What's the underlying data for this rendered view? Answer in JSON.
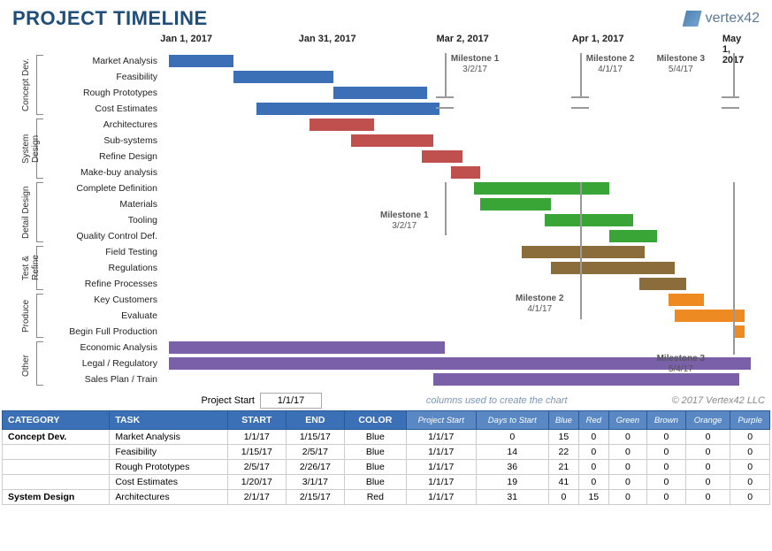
{
  "header": {
    "title": "PROJECT TIMELINE",
    "brand": "vertex42"
  },
  "axis": {
    "dates": [
      "Jan 1, 2017",
      "Jan 31, 2017",
      "Mar 2, 2017",
      "Apr 1, 2017",
      "May 1, 2017"
    ]
  },
  "milestones": [
    {
      "name": "Milestone 1",
      "date": "3/2/17"
    },
    {
      "name": "Milestone 2",
      "date": "4/1/17"
    },
    {
      "name": "Milestone 3",
      "date": "5/4/17"
    }
  ],
  "groups": [
    {
      "name": "Concept Dev.",
      "tasks": [
        "Market Analysis",
        "Feasibility",
        "Rough Prototypes",
        "Cost Estimates"
      ]
    },
    {
      "name": "System Design",
      "tasks": [
        "Architectures",
        "Sub-systems",
        "Refine Design",
        "Make-buy analysis"
      ]
    },
    {
      "name": "Detail Design",
      "tasks": [
        "Complete Definition",
        "Materials",
        "Tooling",
        "Quality Control Def."
      ]
    },
    {
      "name": "Test & Refine",
      "tasks": [
        "Field Testing",
        "Regulations",
        "Refine Processes"
      ]
    },
    {
      "name": "Produce",
      "tasks": [
        "Key Customers",
        "Evaluate",
        "Begin Full Production"
      ]
    },
    {
      "name": "Other",
      "tasks": [
        "Economic Analysis",
        "Legal / Regulatory",
        "Sales Plan / Train"
      ]
    }
  ],
  "milestone_repeat": [
    {
      "name": "Milestone 1",
      "date": "3/2/17"
    },
    {
      "name": "Milestone 2",
      "date": "4/1/17"
    },
    {
      "name": "Milestone 3",
      "date": "5/4/17"
    }
  ],
  "project_start_label": "Project Start",
  "project_start_value": "1/1/17",
  "columns_note": "columns used to create the chart",
  "copyright": "© 2017 Vertex42 LLC",
  "col_headers": [
    "CATEGORY",
    "TASK",
    "START",
    "END",
    "COLOR",
    "Project Start",
    "Days to Start",
    "Blue",
    "Red",
    "Green",
    "Brown",
    "Orange",
    "Purple"
  ],
  "rows": [
    {
      "cat": "Concept Dev.",
      "task": "Market Analysis",
      "start": "1/1/17",
      "end": "1/15/17",
      "color": "Blue",
      "ps": "1/1/17",
      "dts": "0",
      "b": "15",
      "r": "0",
      "g": "0",
      "br": "0",
      "o": "0",
      "p": "0"
    },
    {
      "cat": "",
      "task": "Feasibility",
      "start": "1/15/17",
      "end": "2/5/17",
      "color": "Blue",
      "ps": "1/1/17",
      "dts": "14",
      "b": "22",
      "r": "0",
      "g": "0",
      "br": "0",
      "o": "0",
      "p": "0"
    },
    {
      "cat": "",
      "task": "Rough Prototypes",
      "start": "2/5/17",
      "end": "2/26/17",
      "color": "Blue",
      "ps": "1/1/17",
      "dts": "36",
      "b": "21",
      "r": "0",
      "g": "0",
      "br": "0",
      "o": "0",
      "p": "0"
    },
    {
      "cat": "",
      "task": "Cost Estimates",
      "start": "1/20/17",
      "end": "3/1/17",
      "color": "Blue",
      "ps": "1/1/17",
      "dts": "19",
      "b": "41",
      "r": "0",
      "g": "0",
      "br": "0",
      "o": "0",
      "p": "0"
    },
    {
      "cat": "System Design",
      "task": "Architectures",
      "start": "2/1/17",
      "end": "2/15/17",
      "color": "Red",
      "ps": "1/1/17",
      "dts": "31",
      "b": "0",
      "r": "15",
      "g": "0",
      "br": "0",
      "o": "0",
      "p": "0"
    }
  ],
  "chart_data": {
    "type": "gantt",
    "title": "PROJECT TIMELINE",
    "x_axis": {
      "start": "2017-01-01",
      "end": "2017-05-07",
      "ticks": [
        "2017-01-01",
        "2017-01-31",
        "2017-03-02",
        "2017-04-01",
        "2017-05-01"
      ]
    },
    "milestones": [
      {
        "name": "Milestone 1",
        "date": "2017-03-02"
      },
      {
        "name": "Milestone 2",
        "date": "2017-04-01"
      },
      {
        "name": "Milestone 3",
        "date": "2017-05-04"
      }
    ],
    "groups": [
      {
        "name": "Concept Dev.",
        "color": "Blue",
        "tasks": [
          {
            "name": "Market Analysis",
            "start": "2017-01-01",
            "end": "2017-01-15"
          },
          {
            "name": "Feasibility",
            "start": "2017-01-15",
            "end": "2017-02-05"
          },
          {
            "name": "Rough Prototypes",
            "start": "2017-02-05",
            "end": "2017-02-26"
          },
          {
            "name": "Cost Estimates",
            "start": "2017-01-20",
            "end": "2017-03-01"
          }
        ]
      },
      {
        "name": "System Design",
        "color": "Red",
        "tasks": [
          {
            "name": "Architectures",
            "start": "2017-02-01",
            "end": "2017-02-15"
          },
          {
            "name": "Sub-systems",
            "start": "2017-02-10",
            "end": "2017-02-28"
          },
          {
            "name": "Refine Design",
            "start": "2017-02-25",
            "end": "2017-03-05"
          },
          {
            "name": "Make-buy analysis",
            "start": "2017-03-03",
            "end": "2017-03-09"
          }
        ]
      },
      {
        "name": "Detail Design",
        "color": "Green",
        "tasks": [
          {
            "name": "Complete Definition",
            "start": "2017-03-09",
            "end": "2017-04-08"
          },
          {
            "name": "Materials",
            "start": "2017-03-10",
            "end": "2017-03-25"
          },
          {
            "name": "Tooling",
            "start": "2017-03-24",
            "end": "2017-04-12"
          },
          {
            "name": "Quality Control Def.",
            "start": "2017-04-08",
            "end": "2017-04-18"
          }
        ]
      },
      {
        "name": "Test & Refine",
        "color": "Brown",
        "tasks": [
          {
            "name": "Field Testing",
            "start": "2017-03-20",
            "end": "2017-04-16"
          },
          {
            "name": "Regulations",
            "start": "2017-03-26",
            "end": "2017-04-22"
          },
          {
            "name": "Refine Processes",
            "start": "2017-04-14",
            "end": "2017-04-24"
          }
        ]
      },
      {
        "name": "Produce",
        "color": "Orange",
        "tasks": [
          {
            "name": "Key Customers",
            "start": "2017-04-20",
            "end": "2017-04-28"
          },
          {
            "name": "Evaluate",
            "start": "2017-04-22",
            "end": "2017-05-07"
          },
          {
            "name": "Begin Full Production",
            "start": "2017-05-04",
            "end": "2017-05-07"
          }
        ]
      },
      {
        "name": "Other",
        "color": "Purple",
        "tasks": [
          {
            "name": "Economic Analysis",
            "start": "2017-01-01",
            "end": "2017-03-02"
          },
          {
            "name": "Legal / Regulatory",
            "start": "2017-01-01",
            "end": "2017-05-07"
          },
          {
            "name": "Sales Plan / Train",
            "start": "2017-02-28",
            "end": "2017-05-02"
          }
        ]
      }
    ],
    "colors": {
      "Blue": "#3b6fb6",
      "Red": "#c0504d",
      "Green": "#3aa537",
      "Brown": "#8a6d3b",
      "Orange": "#ed8b22",
      "Purple": "#7960a8"
    }
  }
}
